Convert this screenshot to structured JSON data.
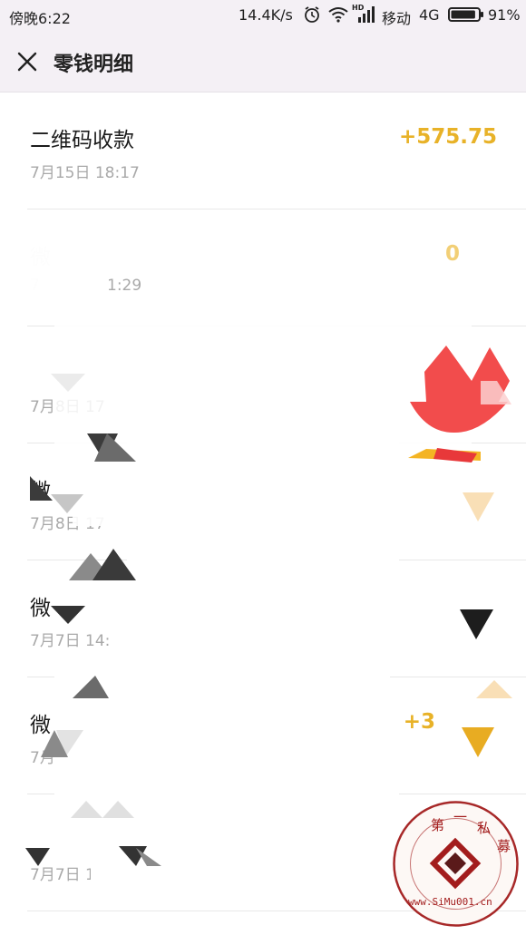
{
  "status_bar": {
    "time": "傍晚6:22",
    "speed": "14.4K/s",
    "hd_label": "HD",
    "carrier": "移动",
    "network": "4G",
    "battery": "91%",
    "alarm_icon": "alarm-icon",
    "wifi_icon": "wifi-icon",
    "signal_icon": "signal-icon",
    "battery_icon": "battery-icon",
    "battery_level": 0.91
  },
  "header": {
    "title": "零钱明细",
    "close_icon": "close-icon"
  },
  "transactions": [
    {
      "title": "二维码收款",
      "time": "7月15日 18:17",
      "amount": "+575.75"
    },
    {
      "title": "微",
      "time": "7",
      "time_tail": "1:29",
      "amount": "0"
    },
    {
      "title": "",
      "time": "7月8日 17",
      "amount": ""
    },
    {
      "title": "微",
      "time": "7月8日 17",
      "amount": ""
    },
    {
      "title": "微",
      "time": "7月7日 14:48",
      "amount": ""
    },
    {
      "title": "微",
      "time": "7月",
      "amount": "+3"
    },
    {
      "title": "",
      "time": "7月7日 13:20",
      "amount": ""
    }
  ],
  "watermark": {
    "text": "第一私募 www.SiMu001.cn"
  },
  "colors": {
    "amount": "#e8b228",
    "header_bg": "#f4f0f5",
    "watermark": "#a31d1d"
  }
}
